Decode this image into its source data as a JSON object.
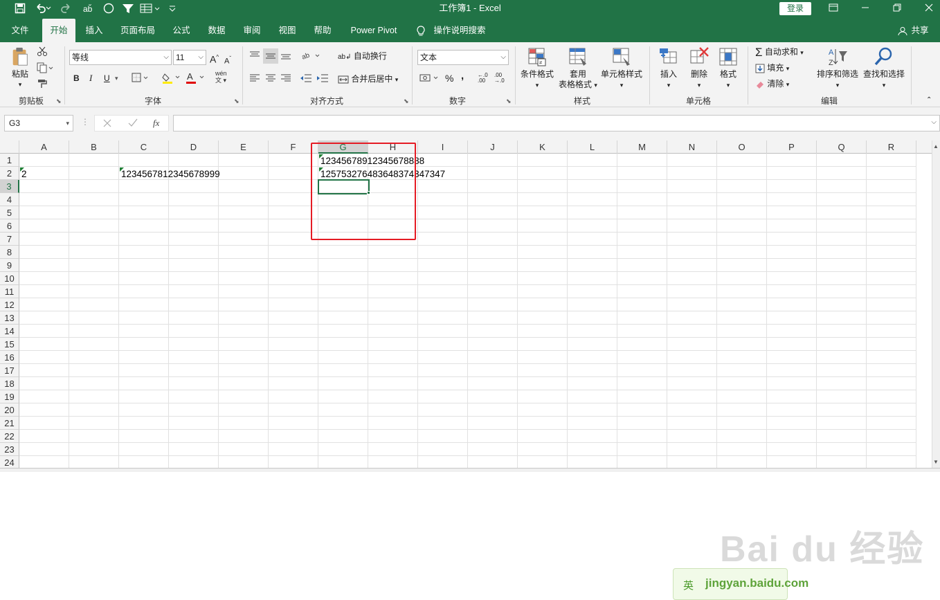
{
  "titlebar": {
    "title": "工作簿1  -  Excel",
    "login": "登录",
    "colors": {
      "brand": "#217346"
    }
  },
  "menu": {
    "tabs": [
      {
        "label": "文件"
      },
      {
        "label": "开始"
      },
      {
        "label": "插入"
      },
      {
        "label": "页面布局"
      },
      {
        "label": "公式"
      },
      {
        "label": "数据"
      },
      {
        "label": "审阅"
      },
      {
        "label": "视图"
      },
      {
        "label": "帮助"
      },
      {
        "label": "Power Pivot"
      },
      {
        "label": "操作说明搜索"
      }
    ],
    "share": "共享"
  },
  "ribbon": {
    "clipboard": {
      "paste": "粘贴",
      "group": "剪贴板"
    },
    "font": {
      "name": "等线",
      "size": "11",
      "group": "字体",
      "bold": "B",
      "italic": "I",
      "underline": "U",
      "grow": "A",
      "shrink": "A",
      "font_color": "A",
      "phonetic": "wén"
    },
    "alignment": {
      "wrap": "自动换行",
      "merge": "合并后居中",
      "group": "对齐方式"
    },
    "number": {
      "format": "文本",
      "group": "数字",
      "percent": "%",
      "comma": ","
    },
    "styles": {
      "conditional": "条件格式",
      "table1": "套用",
      "table2": "表格格式",
      "cell": "单元格样式",
      "group": "样式"
    },
    "cells": {
      "insert": "插入",
      "delete": "删除",
      "format": "格式",
      "group": "单元格"
    },
    "editing": {
      "autosum": "自动求和",
      "fill": "填充",
      "clear": "清除",
      "sort": "排序和筛选",
      "find": "查找和选择",
      "group": "编辑"
    }
  },
  "formula_bar": {
    "name_box": "G3",
    "fx": "fx",
    "formula": ""
  },
  "grid": {
    "columns": [
      "A",
      "B",
      "C",
      "D",
      "E",
      "F",
      "G",
      "H",
      "I",
      "J",
      "K",
      "L",
      "M",
      "N",
      "O",
      "P",
      "Q",
      "R"
    ],
    "rows": [
      "1",
      "2",
      "3",
      "4",
      "5",
      "6",
      "7",
      "8",
      "9",
      "10",
      "11",
      "12",
      "13",
      "14",
      "15",
      "16",
      "17",
      "18",
      "19",
      "20",
      "21",
      "22",
      "23",
      "24"
    ],
    "selected_cell": "G3",
    "cells": {
      "A2": "2",
      "C2": "1234567812345678999",
      "G1": "12345678912345678888",
      "G2": "125753276483648374347347"
    }
  },
  "watermark": {
    "brand": "Bai du 经验",
    "ime": "英",
    "site": "jingyan.baidu.com"
  }
}
